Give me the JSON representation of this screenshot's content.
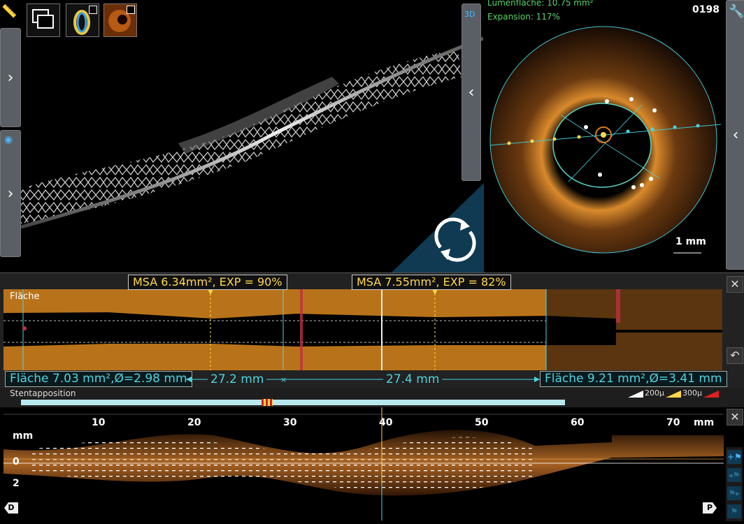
{
  "top_right": {
    "lumen_area": "Lumenfläche: 10.75 mm²",
    "expansion": "Expansion: 117%",
    "frame_number": "0198",
    "scale": "1 mm"
  },
  "view3d_badge": "3D",
  "measure_labels": {
    "msa_left": "MSA 6.34mm², EXP = 90%",
    "msa_right": "MSA 7.55mm², EXP = 82%",
    "area_left": "Fläche 7.03 mm²,Ø=2.98 mm",
    "area_right": "Fläche 9.21 mm²,Ø=3.41 mm",
    "length_left": "27.2 mm",
    "length_right": "27.4 mm"
  },
  "panel_area": {
    "title": "Fläche"
  },
  "apposition": {
    "title": "Stentapposition",
    "legend": [
      "200µ",
      "300µ"
    ]
  },
  "long_view": {
    "ticks": [
      "10",
      "20",
      "30",
      "40",
      "50",
      "60",
      "70"
    ],
    "unit": "mm",
    "depth_unit": "mm",
    "depth_ticks": [
      "0",
      "2"
    ],
    "distal_marker": "D",
    "proximal_marker": "P"
  },
  "colors": {
    "area_orange": "#b8731a",
    "cyan": "#4fd3e0",
    "yellow": "#ffd84a",
    "tab_grey": "#5a5f66"
  }
}
